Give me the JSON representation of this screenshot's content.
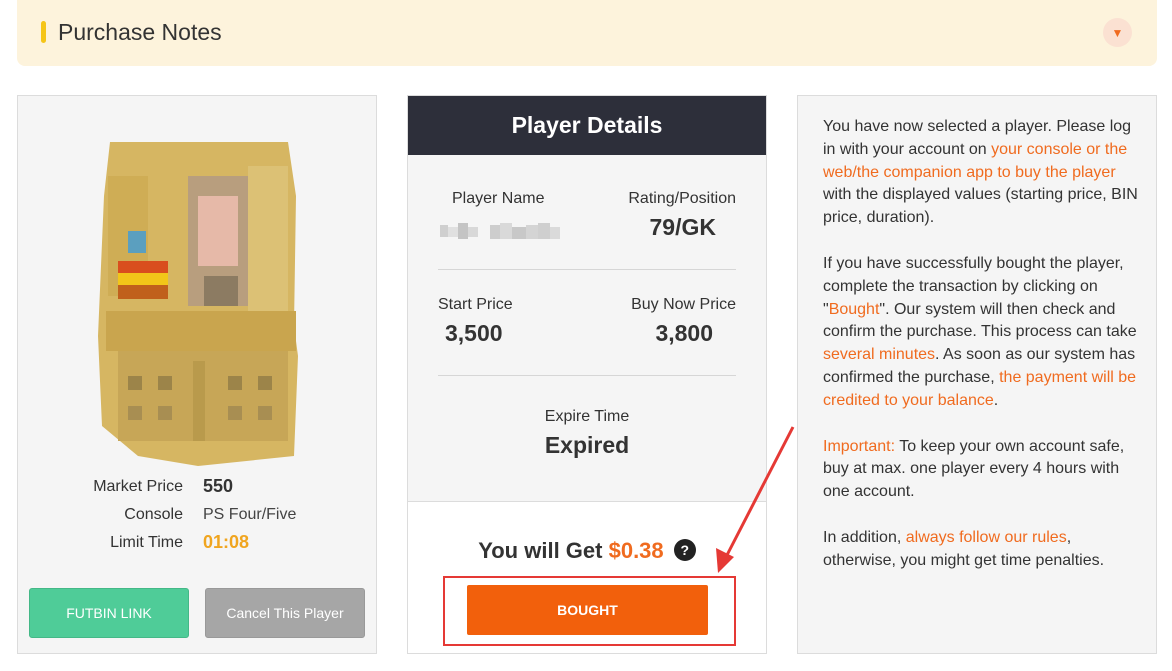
{
  "notes_bar": {
    "title": "Purchase Notes"
  },
  "player_card": {
    "market_price_label": "Market Price",
    "market_price_value": "550",
    "console_label": "Console",
    "console_value": "PS Four/Five",
    "limit_time_label": "Limit Time",
    "limit_time_value": "01:08",
    "futbin_button": "FUTBIN LINK",
    "cancel_button": "Cancel This Player"
  },
  "player_details": {
    "title": "Player Details",
    "player_name_label": "Player Name",
    "rating_position_label": "Rating/Position",
    "rating_position_value": "79/GK",
    "start_price_label": "Start Price",
    "start_price_value": "3,500",
    "buy_now_price_label": "Buy Now Price",
    "buy_now_price_value": "3,800",
    "expire_time_label": "Expire Time",
    "expire_time_value": "Expired",
    "you_will_get_label": "You will Get",
    "you_will_get_amount": "$0.38",
    "help_glyph": "?",
    "bought_button": "BOUGHT"
  },
  "instructions": {
    "p1_a": "You have now selected a player. Please log in with your account on ",
    "p1_hl": "your console or the web/the companion app to buy the player",
    "p1_b": " with the displayed values (starting price, BIN price, duration).",
    "p2_a": "If you have successfully bought the player, complete the transaction by clicking on \"",
    "p2_hl1": "Bought",
    "p2_b": "\". Our system will then check and confirm the purchase. This process can take ",
    "p2_hl2": "several minutes",
    "p2_c": ". As soon as our system has confirmed the purchase, ",
    "p2_hl3": "the payment will be credited to your balance",
    "p2_d": ".",
    "p3_hl": "Important:",
    "p3_b": " To keep your own account safe, buy at max. one player every 4 hours with one account.",
    "p4_a": "In addition, ",
    "p4_hl": "always follow our rules",
    "p4_b": ", otherwise, you might get time penalties."
  },
  "colors": {
    "accent_orange": "#f06b1f",
    "bought_button": "#f2600c",
    "futbin_button": "#4fcc98",
    "header_dark": "#2d2f3a",
    "annotation_red": "#e53935"
  },
  "icons": {
    "toggle": "chevron-down-icon",
    "help": "question-circle-icon",
    "annotation": "red-arrow"
  }
}
